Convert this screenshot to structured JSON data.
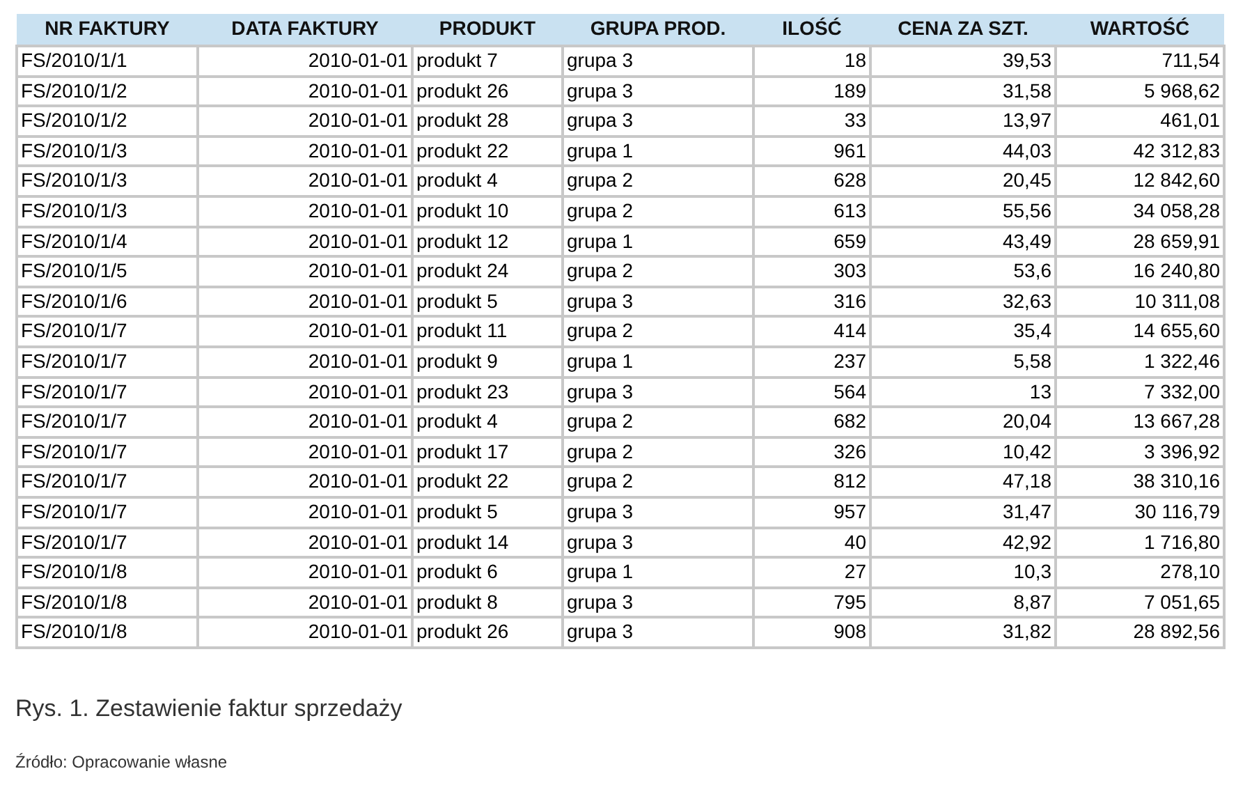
{
  "table": {
    "columns": [
      "NR FAKTURY",
      "DATA FAKTURY",
      "PRODUKT",
      "GRUPA PROD.",
      "ILOŚĆ",
      "CENA ZA SZT.",
      "WARTOŚĆ"
    ],
    "rows": [
      [
        "FS/2010/1/1",
        "2010-01-01",
        "produkt 7",
        "grupa 3",
        "18",
        "39,53",
        "711,54"
      ],
      [
        "FS/2010/1/2",
        "2010-01-01",
        "produkt 26",
        "grupa 3",
        "189",
        "31,58",
        "5 968,62"
      ],
      [
        "FS/2010/1/2",
        "2010-01-01",
        "produkt 28",
        "grupa 3",
        "33",
        "13,97",
        "461,01"
      ],
      [
        "FS/2010/1/3",
        "2010-01-01",
        "produkt 22",
        "grupa 1",
        "961",
        "44,03",
        "42 312,83"
      ],
      [
        "FS/2010/1/3",
        "2010-01-01",
        "produkt 4",
        "grupa 2",
        "628",
        "20,45",
        "12 842,60"
      ],
      [
        "FS/2010/1/3",
        "2010-01-01",
        "produkt 10",
        "grupa 2",
        "613",
        "55,56",
        "34 058,28"
      ],
      [
        "FS/2010/1/4",
        "2010-01-01",
        "produkt 12",
        "grupa 1",
        "659",
        "43,49",
        "28 659,91"
      ],
      [
        "FS/2010/1/5",
        "2010-01-01",
        "produkt 24",
        "grupa 2",
        "303",
        "53,6",
        "16 240,80"
      ],
      [
        "FS/2010/1/6",
        "2010-01-01",
        "produkt 5",
        "grupa 3",
        "316",
        "32,63",
        "10 311,08"
      ],
      [
        "FS/2010/1/7",
        "2010-01-01",
        "produkt 11",
        "grupa 2",
        "414",
        "35,4",
        "14 655,60"
      ],
      [
        "FS/2010/1/7",
        "2010-01-01",
        "produkt 9",
        "grupa 1",
        "237",
        "5,58",
        "1 322,46"
      ],
      [
        "FS/2010/1/7",
        "2010-01-01",
        "produkt 23",
        "grupa 3",
        "564",
        "13",
        "7 332,00"
      ],
      [
        "FS/2010/1/7",
        "2010-01-01",
        "produkt 4",
        "grupa 2",
        "682",
        "20,04",
        "13 667,28"
      ],
      [
        "FS/2010/1/7",
        "2010-01-01",
        "produkt 17",
        "grupa 2",
        "326",
        "10,42",
        "3 396,92"
      ],
      [
        "FS/2010/1/7",
        "2010-01-01",
        "produkt 22",
        "grupa 2",
        "812",
        "47,18",
        "38 310,16"
      ],
      [
        "FS/2010/1/7",
        "2010-01-01",
        "produkt 5",
        "grupa 3",
        "957",
        "31,47",
        "30 116,79"
      ],
      [
        "FS/2010/1/7",
        "2010-01-01",
        "produkt 14",
        "grupa 3",
        "40",
        "42,92",
        "1 716,80"
      ],
      [
        "FS/2010/1/8",
        "2010-01-01",
        "produkt 6",
        "grupa 1",
        "27",
        "10,3",
        "278,10"
      ],
      [
        "FS/2010/1/8",
        "2010-01-01",
        "produkt 8",
        "grupa 3",
        "795",
        "8,87",
        "7 051,65"
      ],
      [
        "FS/2010/1/8",
        "2010-01-01",
        "produkt 26",
        "grupa 3",
        "908",
        "31,82",
        "28 892,56"
      ]
    ]
  },
  "caption": "Rys. 1. Zestawienie faktur sprzedaży",
  "source": "Źródło: Opracowanie własne"
}
